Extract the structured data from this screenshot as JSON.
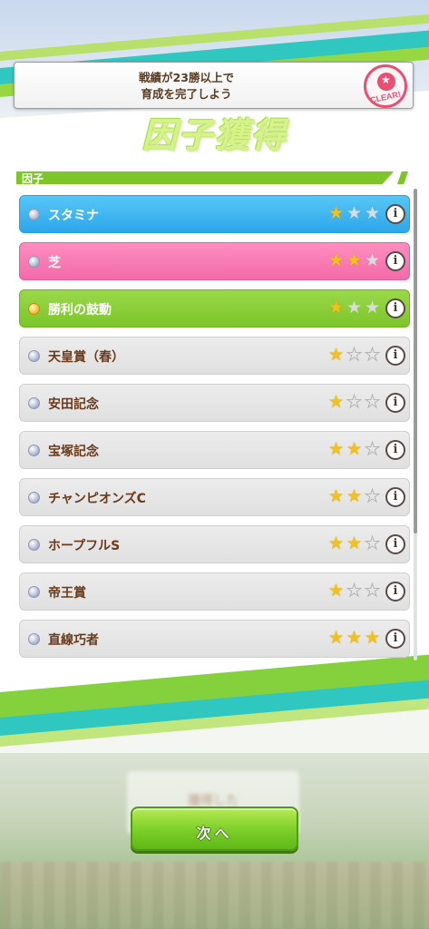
{
  "mission": {
    "line1": "戦績が23勝以上で",
    "line2": "育成を完了しよう",
    "badge": "CLEAR!"
  },
  "title": "因子獲得",
  "section_label": "因子",
  "factors": [
    {
      "name": "スタミナ",
      "stars": 1,
      "style": "blue"
    },
    {
      "name": "芝",
      "stars": 2,
      "style": "pink"
    },
    {
      "name": "勝利の鼓動",
      "stars": 1,
      "style": "green"
    },
    {
      "name": "天皇賞（春）",
      "stars": 1,
      "style": "gray"
    },
    {
      "name": "安田記念",
      "stars": 1,
      "style": "gray"
    },
    {
      "name": "宝塚記念",
      "stars": 2,
      "style": "gray"
    },
    {
      "name": "チャンピオンズC",
      "stars": 2,
      "style": "gray"
    },
    {
      "name": "ホープフルS",
      "stars": 2,
      "style": "gray"
    },
    {
      "name": "帝王賞",
      "stars": 1,
      "style": "gray"
    },
    {
      "name": "直線巧者",
      "stars": 3,
      "style": "gray"
    }
  ],
  "info_glyph": "i",
  "next_button": "次へ",
  "background_panel": "獲得した",
  "colors": {
    "stamina_blue": "#2ea7ea",
    "turf_pink": "#f26aa8",
    "unique_green": "#7cc62a",
    "star_gold": "#f2c21a",
    "text_brown": "#6a3a1a"
  }
}
